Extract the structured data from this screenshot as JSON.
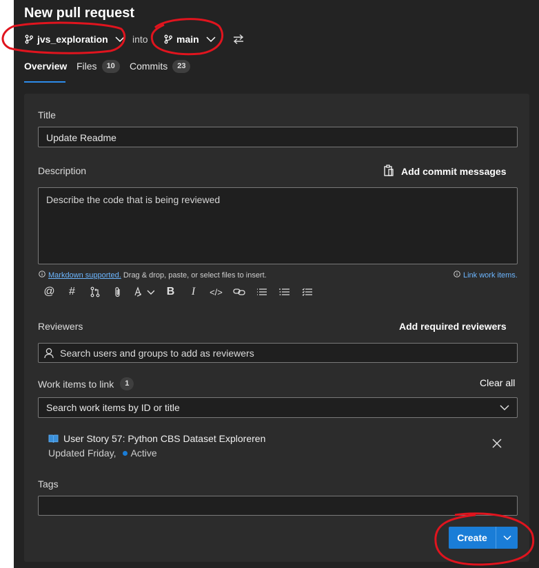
{
  "page": {
    "title": "New pull request"
  },
  "branches": {
    "source": "jvs_exploration",
    "into_label": "into",
    "target": "main",
    "swap_icon": "swap-arrows-icon"
  },
  "tabs": [
    {
      "label": "Overview",
      "count": null,
      "active": true
    },
    {
      "label": "Files",
      "count": "10",
      "active": false
    },
    {
      "label": "Commits",
      "count": "23",
      "active": false
    }
  ],
  "form": {
    "title_label": "Title",
    "title_value": "Update Readme",
    "description_label": "Description",
    "add_commit_messages": "Add commit messages",
    "description_placeholder": "Describe the code that is being reviewed",
    "markdown_link": "Markdown supported.",
    "markdown_hint": " Drag & drop, paste, or select files to insert.",
    "link_work_items": "Link work items.",
    "reviewers_label": "Reviewers",
    "add_required_reviewers": "Add required reviewers",
    "reviewers_placeholder": "Search users and groups to add as reviewers",
    "work_items_label": "Work items to link",
    "work_items_count": "1",
    "clear_all": "Clear all",
    "work_items_placeholder": "Search work items by ID or title",
    "work_item": {
      "title": "User Story 57: Python CBS Dataset Exploreren",
      "updated": "Updated Friday,",
      "state": "Active",
      "state_color": "#1a7dd7",
      "icon": "book-icon"
    },
    "tags_label": "Tags",
    "tags_value": ""
  },
  "toolbar_icons": [
    "mention-icon",
    "hashtag-icon",
    "pull-request-icon",
    "attachment-icon",
    "format-icon",
    "bold-icon",
    "italic-icon",
    "code-icon",
    "link-icon",
    "bulleted-list-icon",
    "numbered-list-icon",
    "checklist-icon"
  ],
  "create_button": {
    "label": "Create"
  },
  "colors": {
    "accent": "#1a7dd7",
    "annotation": "#e0141e",
    "background": "#232323",
    "card": "#2c2c2c"
  }
}
